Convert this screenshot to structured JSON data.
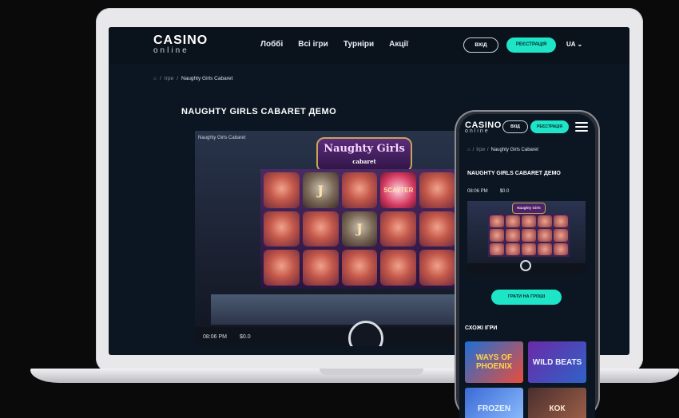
{
  "laptop": {
    "logo_main": "CASINO",
    "logo_sub": "online",
    "nav": [
      "Лоббі",
      "Всі ігри",
      "Турніри",
      "Акції"
    ],
    "login": "ВХІД",
    "register": "РЕЄСТРАЦІЯ",
    "lang": "UA",
    "breadcrumb": [
      "Ігри",
      "Naughty Girls Cabaret"
    ],
    "title": "NAUGHTY GIRLS CABARET ДЕМО",
    "game": {
      "frame_name": "Naughty Girls Cabaret",
      "logo": "Naughty Girls",
      "logo_sub": "cabaret",
      "time": "08:06 PM",
      "balance": "$0.0",
      "scatter": "SCATTER"
    }
  },
  "phone": {
    "logo_main": "CASINO",
    "logo_sub": "online",
    "login": "ВХІД",
    "register": "РЕЄСТРАЦІЯ",
    "breadcrumb": [
      "Ігри",
      "Naughty Girls Cabaret"
    ],
    "title": "NAUGHTY GIRLS CABARET ДЕМО",
    "time": "08:06 PM",
    "balance": "$0.0",
    "game_logo": "Naughty Girls",
    "play_button": "ГРАТИ НА ГРОШІ",
    "similar_title": "СХОЖІ ІГРИ",
    "similar_games": [
      "WAYS OF PHOENIX",
      "WILD BEATS",
      "FROZEN",
      "КОК"
    ]
  }
}
